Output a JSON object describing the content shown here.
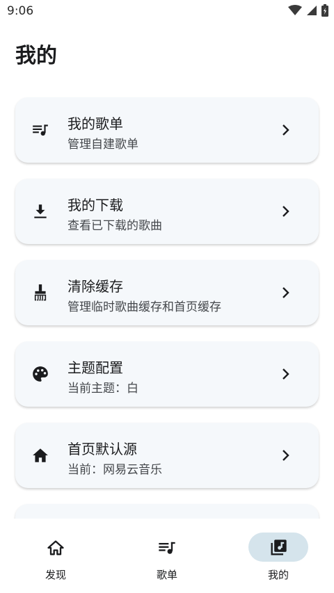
{
  "status_bar": {
    "time": "9:06"
  },
  "page": {
    "title": "我的"
  },
  "menu": [
    {
      "title": "我的歌单",
      "subtitle": "管理自建歌单",
      "icon": "playlist-icon"
    },
    {
      "title": "我的下载",
      "subtitle": "查看已下载的歌曲",
      "icon": "download-icon"
    },
    {
      "title": "清除缓存",
      "subtitle": "管理临时歌曲缓存和首页缓存",
      "icon": "broom-icon"
    },
    {
      "title": "主题配置",
      "subtitle": "当前主题：白",
      "icon": "palette-icon"
    },
    {
      "title": "首页默认源",
      "subtitle": "当前：网易云音乐",
      "icon": "home-icon"
    }
  ],
  "bottom_nav": [
    {
      "label": "发现",
      "icon": "home-outline-icon",
      "selected": false
    },
    {
      "label": "歌单",
      "icon": "playlist-icon",
      "selected": false
    },
    {
      "label": "我的",
      "icon": "library-music-icon",
      "selected": true
    }
  ],
  "colors": {
    "card_bg": "#f5f8fb",
    "selected_pill": "#d5e4ec",
    "text": "#1b1c1e"
  }
}
